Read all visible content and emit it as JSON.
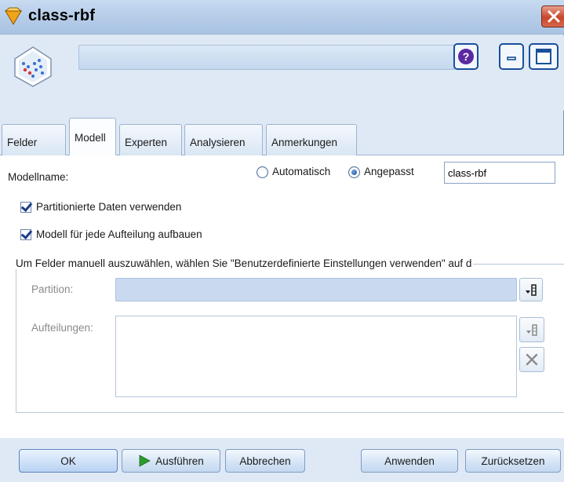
{
  "window": {
    "title": "class-rbf"
  },
  "toolbar": {
    "help_icon": "question-mark-icon",
    "minimize_icon": "minimize-icon",
    "maximize_icon": "maximize-icon"
  },
  "tabs": [
    {
      "label": "Felder",
      "active": false
    },
    {
      "label": "Modell",
      "active": true
    },
    {
      "label": "Experten",
      "active": false
    },
    {
      "label": "Analysieren",
      "active": false
    },
    {
      "label": "Anmerkungen",
      "active": false
    }
  ],
  "model": {
    "name_label": "Modellname:",
    "radio_auto": "Automatisch",
    "radio_custom": "Angepasst",
    "selected": "Angepasst",
    "name_value": "class-rbf",
    "use_partition_label": "Partitionierte Daten verwenden",
    "use_partition_checked": true,
    "build_split_label": "Modell für jede Aufteilung aufbauen",
    "build_split_checked": true
  },
  "fields": {
    "group_text": "Um Felder manuell auszuwählen, wählen Sie \"Benutzerdefinierte Einstellungen verwenden\" auf d",
    "partition_label": "Partition:",
    "partition_value": "",
    "splits_label": "Aufteilungen:"
  },
  "buttons": {
    "ok": "OK",
    "run": "Ausführen",
    "cancel": "Abbrechen",
    "apply": "Anwenden",
    "reset": "Zurücksetzen"
  },
  "colors": {
    "accent": "#1a4f9a",
    "run_icon": "#2e9a2e",
    "close": "#c8452a"
  }
}
